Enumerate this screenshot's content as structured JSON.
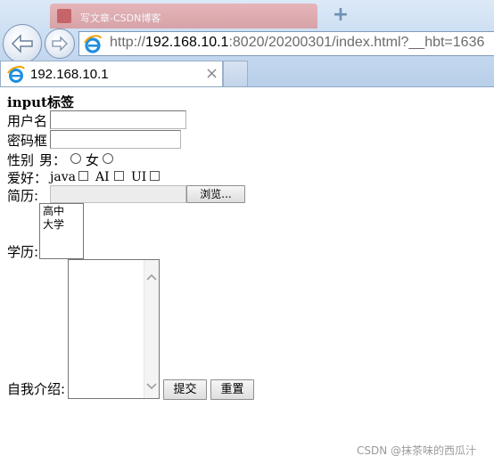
{
  "browser": {
    "background_tab_title": "写文章-CSDN博客",
    "address_url_prefix": "http://",
    "address_url_host": "192.168.10.1",
    "address_url_rest": ":8020/20200301/index.html?__hbt=1636",
    "active_tab_title": "192.168.10.1",
    "tab_close_glyph": "×",
    "new_tab_glyph": "+"
  },
  "page": {
    "heading_latin": "input",
    "heading_cjk": "标签",
    "username_label": "用户名",
    "password_label": "密码框",
    "gender_label": "性别",
    "gender_male": "男：",
    "gender_female": "女",
    "hobby_label": "爱好：",
    "hobby_options": [
      "java",
      "AI",
      "UI"
    ],
    "resume_label": "简历:",
    "browse_label": "浏览...",
    "education_label": "学历:",
    "education_options": [
      "高中",
      "大学"
    ],
    "intro_label": "自我介绍:",
    "submit_label": "提交",
    "reset_label": "重置"
  },
  "watermark": "CSDN @抹茶味的西瓜汁",
  "colors": {
    "chrome_blue": "#c6daf1",
    "ie_icon_blue": "#1e8fe0",
    "ie_icon_orange": "#f0a30a"
  }
}
